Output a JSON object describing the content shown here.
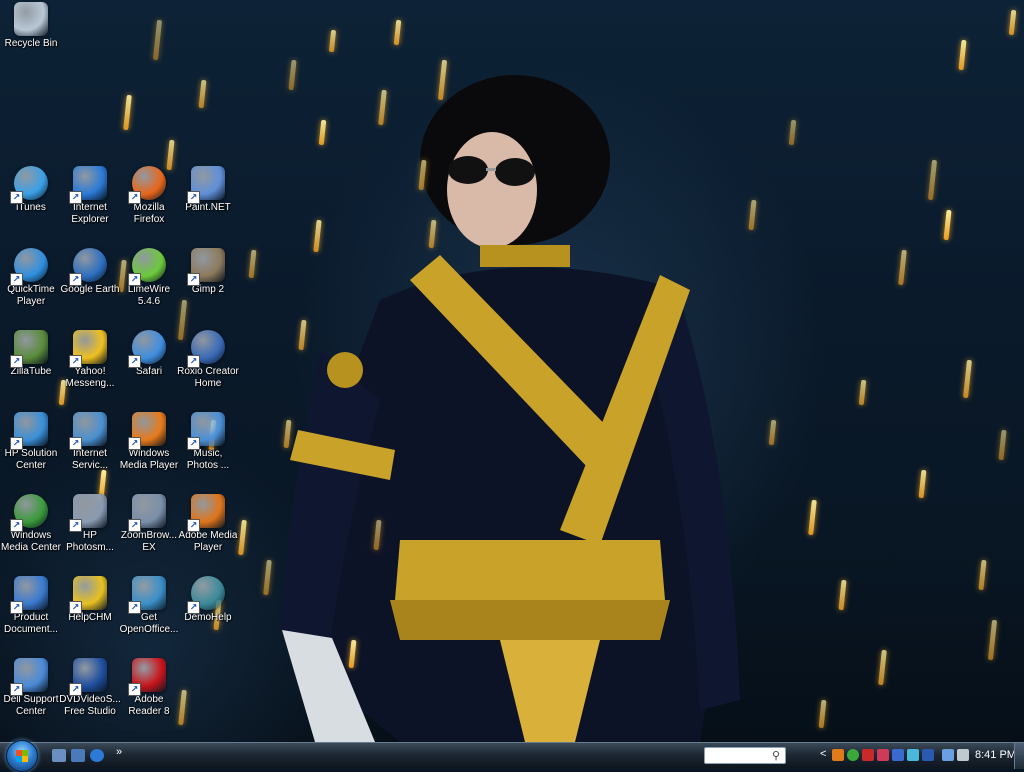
{
  "desktop": {
    "icons": [
      {
        "label": "Recycle Bin",
        "icon": "recycle-bin-icon",
        "color": "#b9c7d6"
      },
      {
        "label": "iTunes",
        "icon": "itunes-icon",
        "color": "#3aa0e8"
      },
      {
        "label": "Internet\nExplorer",
        "icon": "internet-explorer-icon",
        "color": "#2b7ad6"
      },
      {
        "label": "Mozilla\nFirefox",
        "icon": "firefox-icon",
        "color": "#e8661b"
      },
      {
        "label": "Paint.NET",
        "icon": "paint-net-icon",
        "color": "#5f8fd8"
      },
      {
        "label": "QuickTime\nPlayer",
        "icon": "quicktime-icon",
        "color": "#2f8fe0"
      },
      {
        "label": "Google Earth",
        "icon": "google-earth-icon",
        "color": "#2d6fc0"
      },
      {
        "label": "LimeWire\n5.4.6",
        "icon": "limewire-icon",
        "color": "#6cc93a"
      },
      {
        "label": "Gimp 2",
        "icon": "gimp-icon",
        "color": "#8c7a5c"
      },
      {
        "label": "ZillaTube",
        "icon": "zillatube-icon",
        "color": "#5a8c3a"
      },
      {
        "label": "Yahoo!\nMesseng...",
        "icon": "yahoo-messenger-icon",
        "color": "#f0c020"
      },
      {
        "label": "Safari",
        "icon": "safari-icon",
        "color": "#3f8ee0"
      },
      {
        "label": "Roxio Creator\nHome",
        "icon": "roxio-icon",
        "color": "#3a6ab8"
      },
      {
        "label": "HP Solution\nCenter",
        "icon": "hp-solution-center-icon",
        "color": "#3a8fd8"
      },
      {
        "label": "Internet\nServic...",
        "icon": "internet-services-icon",
        "color": "#4a90d0"
      },
      {
        "label": "Windows\nMedia Player",
        "icon": "windows-media-player-icon",
        "color": "#e87a1a"
      },
      {
        "label": "Music,\nPhotos ...",
        "icon": "music-photos-icon",
        "color": "#4a8fd8"
      },
      {
        "label": "Windows\nMedia Center",
        "icon": "windows-media-center-icon",
        "color": "#3a9a3a"
      },
      {
        "label": "HP\nPhotosm...",
        "icon": "hp-photosmart-icon",
        "color": "#8a9ab0"
      },
      {
        "label": "ZoomBrow...\nEX",
        "icon": "zoombrowser-icon",
        "color": "#7a8fa8"
      },
      {
        "label": "Adobe Media\nPlayer",
        "icon": "adobe-media-player-icon",
        "color": "#e0741a"
      },
      {
        "label": "Product\nDocument...",
        "icon": "product-documentation-icon",
        "color": "#3a7ad0"
      },
      {
        "label": "HelpCHM",
        "icon": "helpchm-icon",
        "color": "#e8c020"
      },
      {
        "label": "Get\nOpenOffice...",
        "icon": "openoffice-icon",
        "color": "#3a8fc8"
      },
      {
        "label": "DemoHelp",
        "icon": "demohelp-icon",
        "color": "#3a8a9a"
      },
      {
        "label": "Dell Support\nCenter",
        "icon": "dell-support-icon",
        "color": "#4a8ad8"
      },
      {
        "label": "DVDVideoS...\nFree Studio",
        "icon": "dvdvideosoft-icon",
        "color": "#1f4fa0"
      },
      {
        "label": "Adobe\nReader 8",
        "icon": "adobe-reader-icon",
        "color": "#c8141a"
      }
    ]
  },
  "taskbar": {
    "start_label": "Start",
    "search_placeholder": "",
    "clock": "8:41 PM",
    "quick_launch_more": "»",
    "tray_chevron": "<"
  }
}
